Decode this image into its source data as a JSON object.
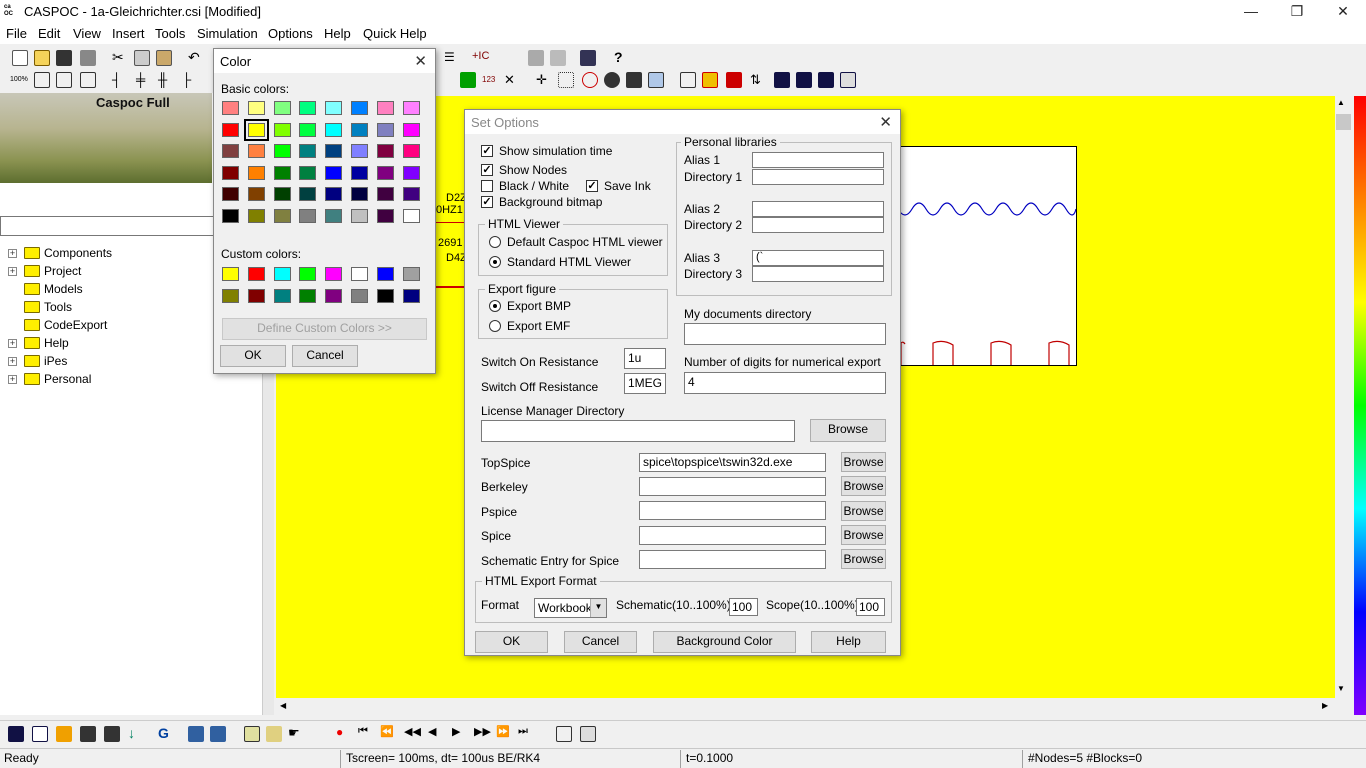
{
  "window": {
    "title": "CASPOC - 1a-Gleichrichter.csi [Modified]",
    "icon_text": "casp\nOC"
  },
  "winbtns": {
    "minimize": "—",
    "restore": "❐",
    "close": "✕"
  },
  "menu": [
    "File",
    "Edit",
    "View",
    "Insert",
    "Tools",
    "Simulation",
    "Options",
    "Help",
    "Quick Help"
  ],
  "toolbar_labels": {
    "zoom": "100%",
    "num": "123",
    "runtime_label": "+IC"
  },
  "left": {
    "banner_label": "Caspoc Full",
    "tree": [
      {
        "label": "Components",
        "expandable": true
      },
      {
        "label": "Project",
        "expandable": true
      },
      {
        "label": "Models",
        "expandable": false
      },
      {
        "label": "Tools",
        "expandable": false
      },
      {
        "label": "CodeExport",
        "expandable": false
      },
      {
        "label": "Help",
        "expandable": true
      },
      {
        "label": "iPes",
        "expandable": true
      },
      {
        "label": "Personal",
        "expandable": true
      }
    ]
  },
  "schematic_fragments": [
    "D2Z",
    "0HZ1",
    "2691",
    "D4Z"
  ],
  "color_dialog": {
    "title": "Color",
    "basic_label": "Basic colors:",
    "custom_label": "Custom colors:",
    "define_custom": "Define Custom Colors >>",
    "ok": "OK",
    "cancel": "Cancel",
    "basic_colors": [
      "#ff8080",
      "#ffff80",
      "#80ff80",
      "#00ff80",
      "#80ffff",
      "#0080ff",
      "#ff80c0",
      "#ff80ff",
      "#ff0000",
      "#ffff00",
      "#80ff00",
      "#00ff40",
      "#00ffff",
      "#0080c0",
      "#8080c0",
      "#ff00ff",
      "#804040",
      "#ff8040",
      "#00ff00",
      "#008080",
      "#004080",
      "#8080ff",
      "#800040",
      "#ff0080",
      "#800000",
      "#ff8000",
      "#008000",
      "#008040",
      "#0000ff",
      "#0000a0",
      "#800080",
      "#8000ff",
      "#400000",
      "#804000",
      "#004000",
      "#004040",
      "#000080",
      "#000040",
      "#400040",
      "#400080",
      "#000000",
      "#808000",
      "#808040",
      "#808080",
      "#408080",
      "#c0c0c0",
      "#400040",
      "#ffffff"
    ],
    "custom_colors": [
      "#ffff00",
      "#ff0000",
      "#00ffff",
      "#00ff00",
      "#ff00ff",
      "#ffffff",
      "#0000ff",
      "#a0a0a0",
      "#808000",
      "#800000",
      "#008080",
      "#008000",
      "#800080",
      "#808080",
      "#000000",
      "#000080"
    ],
    "selected_index": 9
  },
  "set_options": {
    "title": "Set Options",
    "show_sim_time": "Show simulation time",
    "show_nodes": "Show Nodes",
    "black_white": "Black / White",
    "save_ink": "Save Ink",
    "background_bitmap": "Background bitmap",
    "html_viewer_group": "HTML Viewer",
    "default_viewer": "Default Caspoc HTML viewer",
    "standard_viewer": "Standard HTML Viewer",
    "export_figure_group": "Export figure",
    "export_bmp": "Export BMP",
    "export_emf": "Export EMF",
    "switch_on_label": "Switch On Resistance",
    "switch_on_value": "1u",
    "switch_off_label": "Switch Off Resistance",
    "switch_off_value": "1MEG",
    "personal_libraries_group": "Personal libraries",
    "alias1": "Alias 1",
    "dir1": "Directory 1",
    "alias2": "Alias 2",
    "dir2": "Directory 2",
    "alias3": "Alias 3",
    "alias3_value": "(`",
    "dir3": "Directory 3",
    "my_docs_label": "My documents directory",
    "digits_label": "Number of digits for numerical export",
    "digits_value": "4",
    "license_label": "License Manager Directory",
    "browse": "Browse",
    "topspice_label": "TopSpice",
    "topspice_value": "spice\\topspice\\tswin32d.exe",
    "berkeley_label": "Berkeley",
    "pspice_label": "Pspice",
    "spice_label": "Spice",
    "schematic_entry_label": "Schematic Entry for Spice",
    "html_export_group": "HTML Export Format",
    "format_label": "Format",
    "format_value": "Workbook",
    "schematic_pct_label": "Schematic(10..100%)",
    "schematic_pct_value": "100",
    "scope_pct_label": "Scope(10..100%)",
    "scope_pct_value": "100",
    "ok": "OK",
    "cancel": "Cancel",
    "background_color": "Background Color",
    "help": "Help"
  },
  "status": {
    "ready": "Ready",
    "tscreen": "Tscreen= 100ms, dt= 100us BE/RK4",
    "t": "t=0.1000",
    "nodes": "#Nodes=5 #Blocks=0"
  }
}
